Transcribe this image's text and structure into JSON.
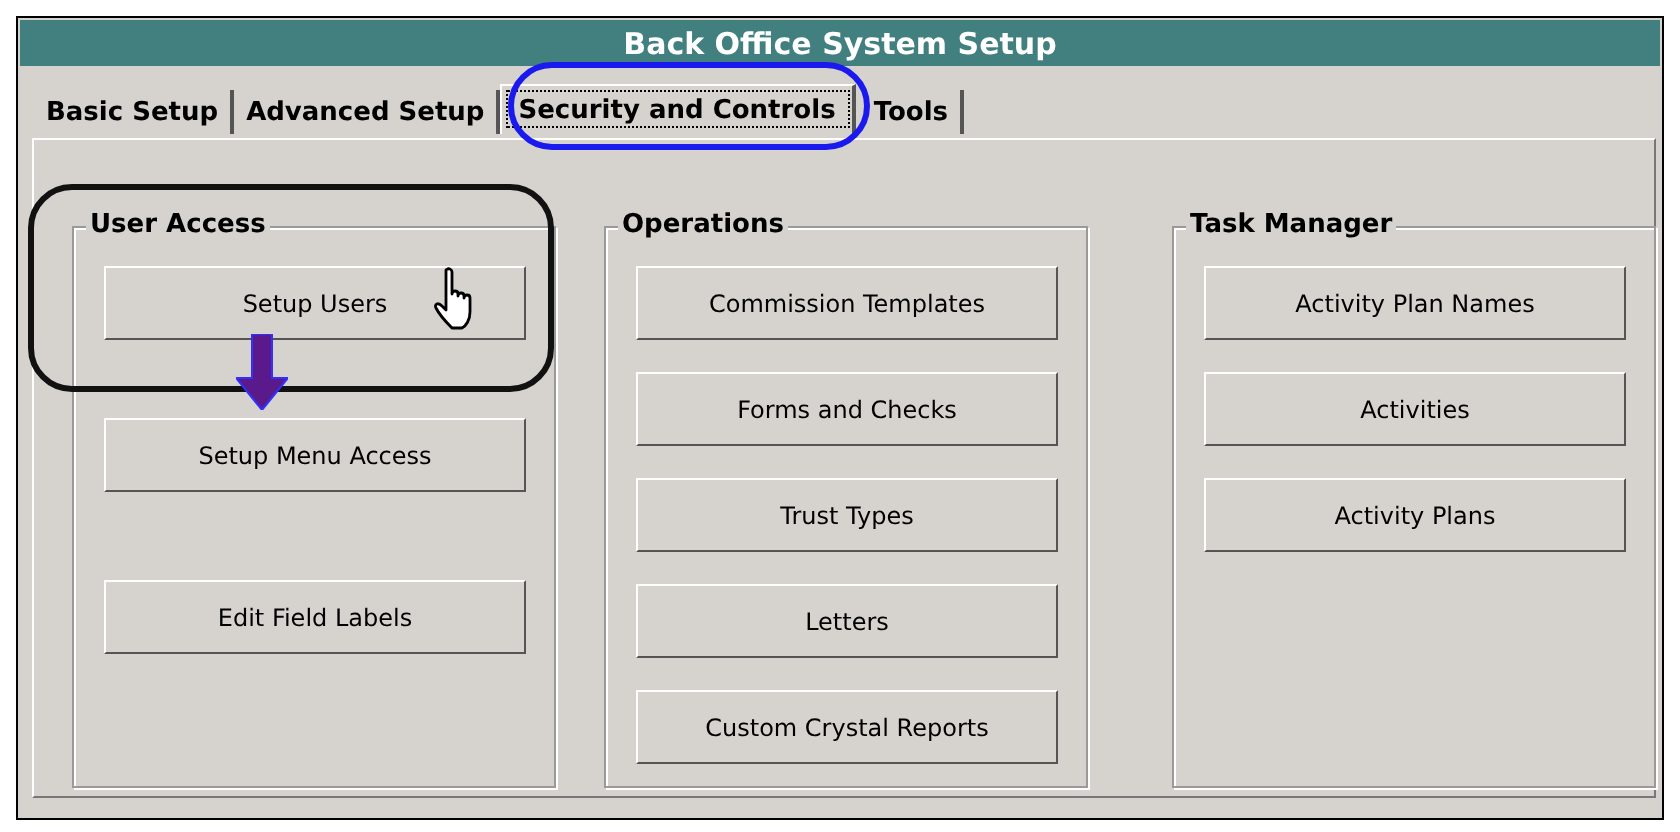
{
  "window": {
    "title": "Back Office System Setup"
  },
  "tabs": [
    {
      "label": "Basic Setup",
      "selected": false
    },
    {
      "label": "Advanced Setup",
      "selected": false
    },
    {
      "label": "Security and Controls",
      "selected": true
    },
    {
      "label": "Tools",
      "selected": false
    }
  ],
  "groups": [
    {
      "title": "User Access",
      "buttons": [
        "Setup Users",
        "Setup Menu Access",
        "Edit Field Labels"
      ]
    },
    {
      "title": "Operations",
      "buttons": [
        "Commission Templates",
        "Forms and Checks",
        "Trust Types",
        "Letters",
        "Custom Crystal Reports"
      ]
    },
    {
      "title": "Task Manager",
      "buttons": [
        "Activity Plan Names",
        "Activities",
        "Activity Plans"
      ]
    }
  ]
}
